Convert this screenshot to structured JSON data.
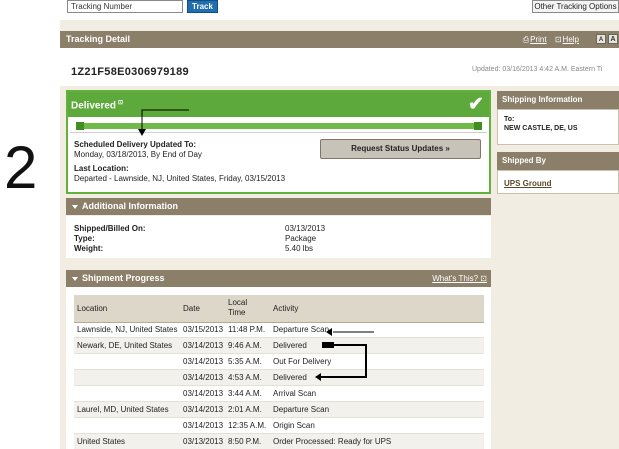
{
  "topbar": {
    "tracking_input_value": "Tracking Number",
    "track_button": "Track",
    "other_options": "Other Tracking Options"
  },
  "tracking_detail": {
    "header": "Tracking Detail",
    "print_link": "Print",
    "help_link": "Help",
    "text_small_btn": "A",
    "text_large_btn": "A",
    "tracking_number": "1Z21F58E0306979189",
    "updated": "Updated: 03/16/2013 4:42 A.M. Eastern Ti"
  },
  "status": {
    "title": "Delivered",
    "info_glyph": "⊡",
    "check_icon": "check-icon",
    "scheduled_label": "Scheduled Delivery Updated To:",
    "scheduled_value": "Monday, 03/18/2013, By End of Day",
    "last_location_label": "Last Location:",
    "last_location_value": "Departed - Lawnside, NJ, United States, Friday, 03/15/2013",
    "request_button": "Request Status Updates »",
    "progress": 1.0
  },
  "annotation_number": "2",
  "sidebar": {
    "shipping_info_header": "Shipping Information",
    "to_label": "To:",
    "to_address": "NEW CASTLE, DE, US",
    "shipped_by_header": "Shipped By",
    "shipped_by_value": "UPS Ground"
  },
  "additional_info": {
    "header": "Additional Information",
    "rows": [
      {
        "label": "Shipped/Billed On:",
        "value": "03/13/2013"
      },
      {
        "label": "Type:",
        "value": "Package"
      },
      {
        "label": "Weight:",
        "value": "5.40 lbs"
      }
    ]
  },
  "shipment_progress": {
    "header": "Shipment Progress",
    "whats_this": "What's This?",
    "columns": [
      "Location",
      "Date",
      "Local Time",
      "Activity"
    ],
    "rows": [
      {
        "location": "Lawnside, NJ, United States",
        "date": "03/15/2013",
        "time": "11:48 P.M.",
        "activity": "Departure Scan"
      },
      {
        "location": "Newark, DE, United States",
        "date": "03/14/2013",
        "time": "9:46 A.M.",
        "activity": "Delivered"
      },
      {
        "location": "",
        "date": "03/14/2013",
        "time": "5:35 A.M.",
        "activity": "Out For Delivery"
      },
      {
        "location": "",
        "date": "03/14/2013",
        "time": "4:53 A.M.",
        "activity": "Delivered"
      },
      {
        "location": "",
        "date": "03/14/2013",
        "time": "3:44 A.M.",
        "activity": "Arrival Scan"
      },
      {
        "location": "Laurel, MD, United States",
        "date": "03/14/2013",
        "time": "2:01 A.M.",
        "activity": "Departure Scan"
      },
      {
        "location": "",
        "date": "03/14/2013",
        "time": "12:35 A.M.",
        "activity": "Origin Scan"
      },
      {
        "location": "United States",
        "date": "03/13/2013",
        "time": "8:50 P.M.",
        "activity": "Order Processed: Ready for UPS"
      }
    ]
  },
  "colors": {
    "header_brown": "#8b7f6a",
    "page_beige": "#f1ede3",
    "delivered_green": "#5ea93b",
    "track_blue": "#1f6fb0"
  }
}
